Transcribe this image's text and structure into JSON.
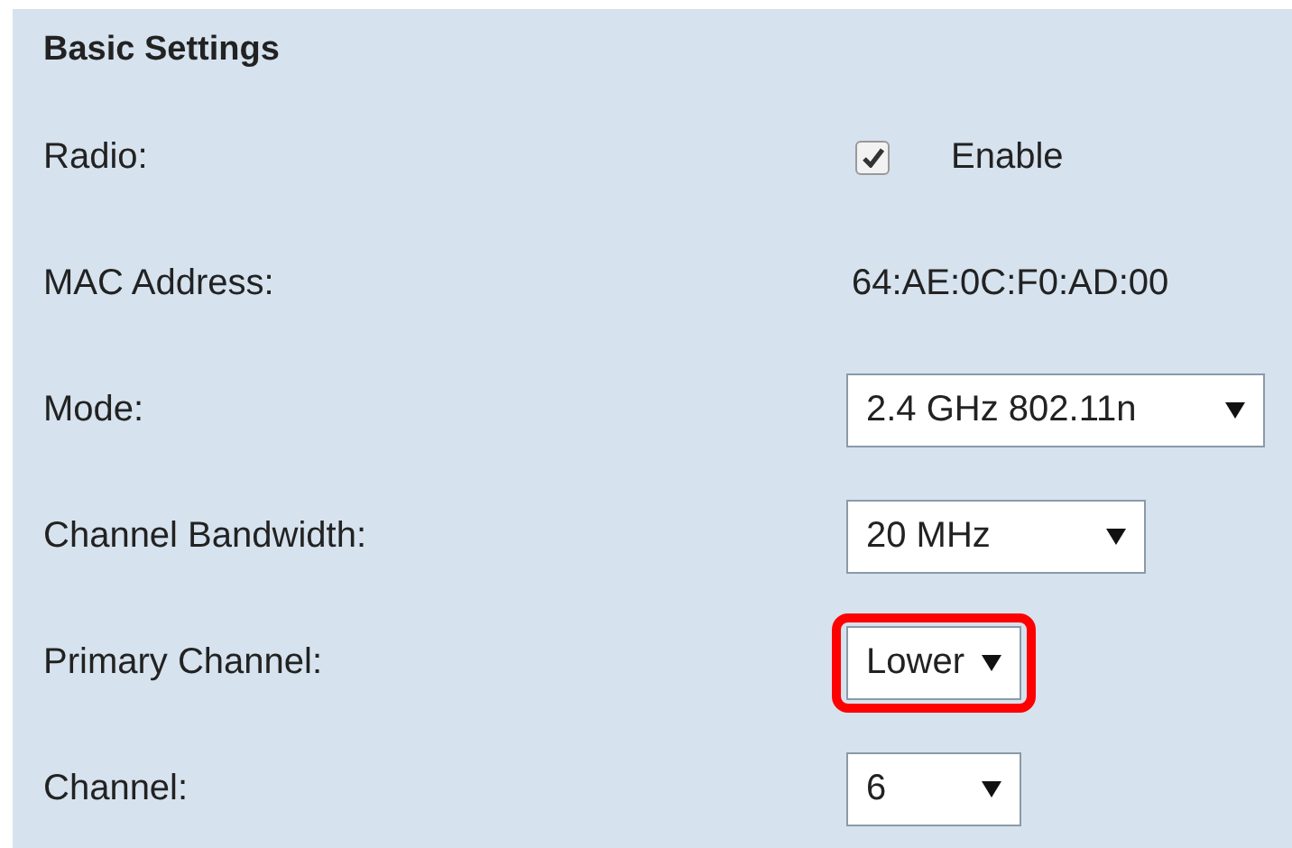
{
  "section": {
    "title": "Basic Settings"
  },
  "rows": [
    {
      "kind": "checkbox",
      "label": "Radio:",
      "checked": true,
      "value": "Enable"
    },
    {
      "kind": "text",
      "label": "MAC Address:",
      "value": "64:AE:0C:F0:AD:00"
    },
    {
      "kind": "select",
      "label": "Mode:",
      "value": "2.4 GHz 802.11n",
      "highlighted": false
    },
    {
      "kind": "select",
      "label": "Channel Bandwidth:",
      "value": "20 MHz",
      "highlighted": false
    },
    {
      "kind": "select",
      "label": "Primary Channel:",
      "value": "Lower",
      "highlighted": true
    },
    {
      "kind": "select",
      "label": "Channel:",
      "value": "6",
      "highlighted": false
    }
  ]
}
